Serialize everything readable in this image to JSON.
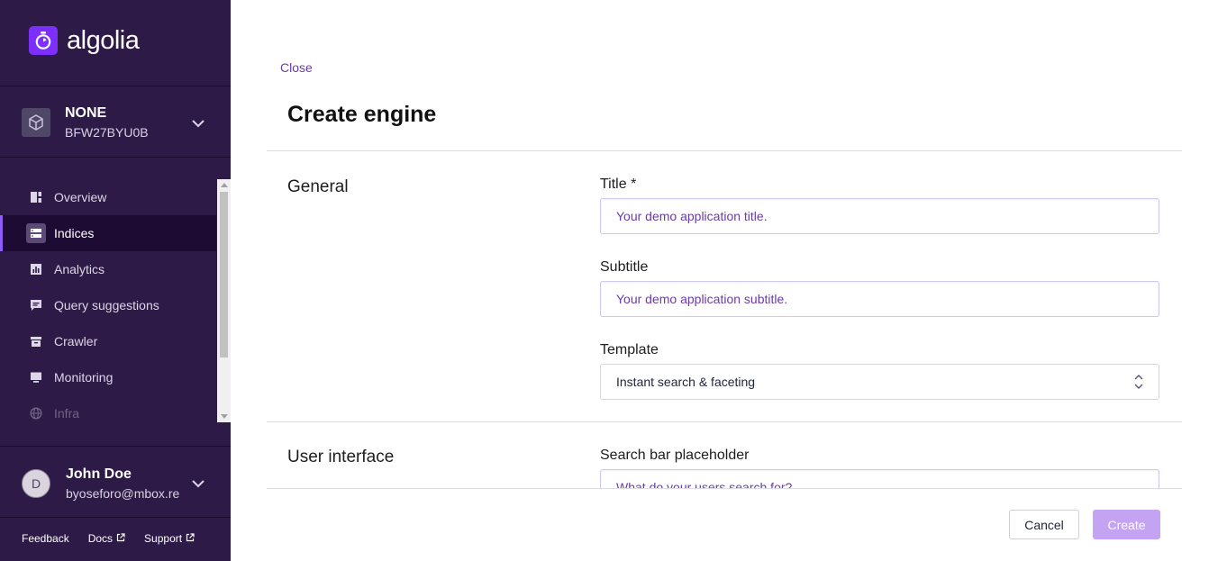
{
  "brand": {
    "name": "algolia",
    "accent": "#7d2fff",
    "sidebar_bg": "#2e1a47"
  },
  "app": {
    "name": "NONE",
    "id": "BFW27BYU0B"
  },
  "nav": [
    {
      "label": "Overview",
      "icon": "overview-icon"
    },
    {
      "label": "Indices",
      "icon": "indices-icon",
      "active": true
    },
    {
      "label": "Analytics",
      "icon": "analytics-icon"
    },
    {
      "label": "Query suggestions",
      "icon": "query-suggestions-icon"
    },
    {
      "label": "Crawler",
      "icon": "crawler-icon"
    },
    {
      "label": "Monitoring",
      "icon": "monitoring-icon"
    },
    {
      "label": "Infra",
      "icon": "infra-icon"
    }
  ],
  "user": {
    "initial": "D",
    "name": "John Doe",
    "email": "byoseforo@mbox.re"
  },
  "footer": {
    "feedback": "Feedback",
    "docs": "Docs",
    "support": "Support"
  },
  "page": {
    "close": "Close",
    "title": "Create engine"
  },
  "general": {
    "title": "General",
    "title_label": "Title *",
    "title_placeholder": "Your demo application title.",
    "subtitle_label": "Subtitle",
    "subtitle_placeholder": "Your demo application subtitle.",
    "template_label": "Template",
    "template_value": "Instant search & faceting"
  },
  "ui": {
    "title": "User interface",
    "search_label": "Search bar placeholder",
    "search_placeholder": "What do your users search for?"
  },
  "actions": {
    "cancel": "Cancel",
    "create": "Create"
  }
}
